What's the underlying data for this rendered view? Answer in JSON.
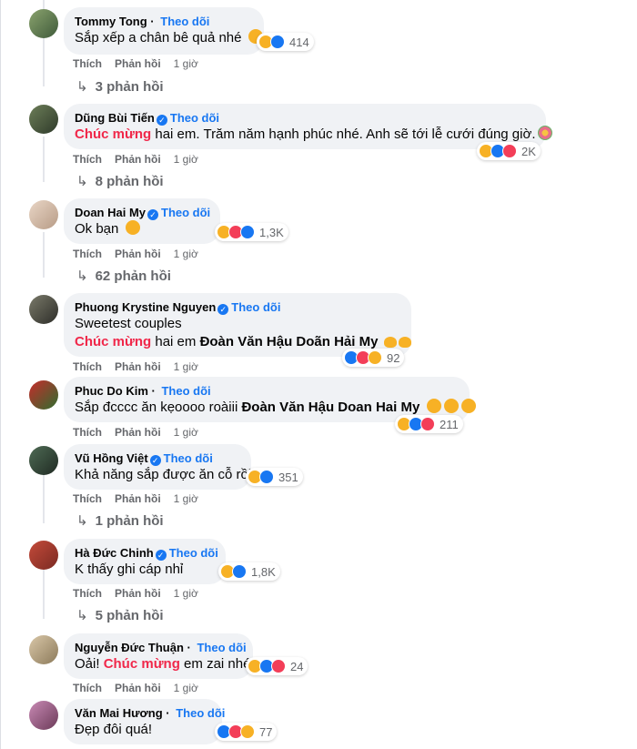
{
  "top_strip": "Thích   Phản hồi   1 giờ",
  "follow_label": "Theo dõi",
  "like_label": "Thích",
  "reply_label": "Phản hồi",
  "time_label": "1 giờ",
  "comments": [
    {
      "name": "Tommy Tong",
      "verified": false,
      "text_before": "Sắp xếp a chân bê quả nhé",
      "reactions": "414",
      "replies": "3 phản hồi"
    },
    {
      "name": "Dũng Bùi Tiến",
      "verified": true,
      "highlight": "Chúc mừng",
      "text_after": " hai em. Trăm năm hạnh phúc nhé. Anh sẽ tới lễ cưới đúng giờ.",
      "reactions": "2K",
      "replies": "8 phản hồi"
    },
    {
      "name": "Doan Hai My",
      "verified": true,
      "text_before": "Ok bạn",
      "reactions": "1,3K",
      "replies": "62 phản hồi"
    },
    {
      "name": "Phuong Krystine Nguyen",
      "verified": true,
      "line1": "Sweetest couples",
      "highlight": "Chúc mừng",
      "text_after": " hai em ",
      "bold_names": "Đoàn Văn Hậu Doãn Hải My",
      "reactions": "92"
    },
    {
      "name": "Phuc Do Kim",
      "verified": false,
      "text_before": "Sắp đcccc ăn kẹoooo roàiii ",
      "bold_names": "Đoàn Văn Hậu Doan Hai My",
      "reactions": "211"
    },
    {
      "name": "Vũ Hồng Việt",
      "verified": true,
      "text_before": "Khả năng sắp được ăn cỗ rồi",
      "reactions": "351",
      "replies": "1 phản hồi"
    },
    {
      "name": "Hà Đức Chinh",
      "verified": true,
      "text_before": "K thấy ghi cáp nhỉ",
      "reactions": "1,8K",
      "replies": "5 phản hồi"
    },
    {
      "name": "Nguyễn Đức Thuận",
      "verified": false,
      "text_before": "Oải! ",
      "highlight": "Chúc mừng",
      "text_after": " em zai nhé",
      "reactions": "24"
    },
    {
      "name": "Văn Mai Hương",
      "verified": false,
      "text_before": "Đẹp đôi quá!",
      "reactions": "77"
    }
  ],
  "colors": {
    "follow": "#1877f2",
    "highlight": "#f0284a",
    "bubble": "#f0f2f5",
    "meta": "#65676b"
  },
  "icons": [
    "haha-icon",
    "like-icon",
    "love-icon",
    "wow-icon",
    "verified-icon",
    "reply-arrow-icon",
    "laugh-emoji-icon",
    "flower-emoji-icon",
    "heart-hands-emoji-icon",
    "heart-eyes-emoji-icon"
  ]
}
